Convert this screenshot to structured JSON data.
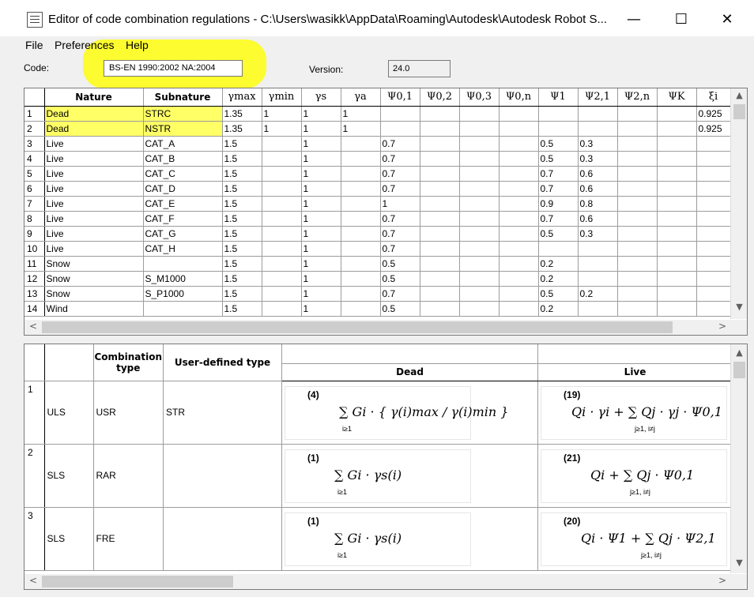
{
  "window": {
    "title": "Editor of code combination regulations - C:\\Users\\wasikk\\AppData\\Roaming\\Autodesk\\Autodesk Robot S...",
    "minimize": "—",
    "maximize": "☐",
    "close": "✕"
  },
  "menu": [
    "File",
    "Preferences",
    "Help"
  ],
  "code": {
    "label": "Code:",
    "value": "BS-EN 1990:2002 NA:2004"
  },
  "version": {
    "label": "Version:",
    "value": "24.0"
  },
  "table1": {
    "headers": [
      "Nature",
      "Subnature",
      "γmax",
      "γmin",
      "γs",
      "γa",
      "Ψ0,1",
      "Ψ0,2",
      "Ψ0,3",
      "Ψ0,n",
      "Ψ1",
      "Ψ2,1",
      "Ψ2,n",
      "ΨK",
      "ξi"
    ],
    "rows": [
      [
        "1",
        "Dead",
        "STRC",
        "1.35",
        "1",
        "1",
        "1",
        "",
        "",
        "",
        "",
        "",
        "",
        "",
        "",
        "0.925"
      ],
      [
        "2",
        "Dead",
        "NSTR",
        "1.35",
        "1",
        "1",
        "1",
        "",
        "",
        "",
        "",
        "",
        "",
        "",
        "",
        "0.925"
      ],
      [
        "3",
        "Live",
        "CAT_A",
        "1.5",
        "",
        "1",
        "",
        "0.7",
        "",
        "",
        "",
        "0.5",
        "0.3",
        "",
        "",
        ""
      ],
      [
        "4",
        "Live",
        "CAT_B",
        "1.5",
        "",
        "1",
        "",
        "0.7",
        "",
        "",
        "",
        "0.5",
        "0.3",
        "",
        "",
        ""
      ],
      [
        "5",
        "Live",
        "CAT_C",
        "1.5",
        "",
        "1",
        "",
        "0.7",
        "",
        "",
        "",
        "0.7",
        "0.6",
        "",
        "",
        ""
      ],
      [
        "6",
        "Live",
        "CAT_D",
        "1.5",
        "",
        "1",
        "",
        "0.7",
        "",
        "",
        "",
        "0.7",
        "0.6",
        "",
        "",
        ""
      ],
      [
        "7",
        "Live",
        "CAT_E",
        "1.5",
        "",
        "1",
        "",
        "1",
        "",
        "",
        "",
        "0.9",
        "0.8",
        "",
        "",
        ""
      ],
      [
        "8",
        "Live",
        "CAT_F",
        "1.5",
        "",
        "1",
        "",
        "0.7",
        "",
        "",
        "",
        "0.7",
        "0.6",
        "",
        "",
        ""
      ],
      [
        "9",
        "Live",
        "CAT_G",
        "1.5",
        "",
        "1",
        "",
        "0.7",
        "",
        "",
        "",
        "0.5",
        "0.3",
        "",
        "",
        ""
      ],
      [
        "10",
        "Live",
        "CAT_H",
        "1.5",
        "",
        "1",
        "",
        "0.7",
        "",
        "",
        "",
        "",
        "",
        "",
        "",
        ""
      ],
      [
        "11",
        "Snow",
        "",
        "1.5",
        "",
        "1",
        "",
        "0.5",
        "",
        "",
        "",
        "0.2",
        "",
        "",
        "",
        ""
      ],
      [
        "12",
        "Snow",
        "S_M1000",
        "1.5",
        "",
        "1",
        "",
        "0.5",
        "",
        "",
        "",
        "0.2",
        "",
        "",
        "",
        ""
      ],
      [
        "13",
        "Snow",
        "S_P1000",
        "1.5",
        "",
        "1",
        "",
        "0.7",
        "",
        "",
        "",
        "0.5",
        "0.2",
        "",
        "",
        ""
      ],
      [
        "14",
        "Wind",
        "",
        "1.5",
        "",
        "1",
        "",
        "0.5",
        "",
        "",
        "",
        "0.2",
        "",
        "",
        "",
        ""
      ]
    ]
  },
  "table2": {
    "headers": {
      "combination_type": "Combination type",
      "user_defined_type": "User-defined type",
      "dead": "Dead",
      "live": "Live"
    },
    "rows": [
      {
        "num": "1",
        "state": "ULS",
        "type": "USR",
        "user": "STR",
        "dead": {
          "id": "(4)",
          "expr": "∑ Gi · { γ(i)max / γ(i)min }",
          "sub": "i≥1"
        },
        "live": {
          "id": "(19)",
          "expr": "Qi · γi  +  ∑ Qj · γj · Ψ0,1",
          "sub": "j≥1, i≠j"
        }
      },
      {
        "num": "2",
        "state": "SLS",
        "type": "RAR",
        "user": "",
        "dead": {
          "id": "(1)",
          "expr": "∑ Gi · γs(i)",
          "sub": "i≥1"
        },
        "live": {
          "id": "(21)",
          "expr": "Qi  +  ∑ Qj · Ψ0,1",
          "sub": "j≥1, i≠j"
        }
      },
      {
        "num": "3",
        "state": "SLS",
        "type": "FRE",
        "user": "",
        "dead": {
          "id": "(1)",
          "expr": "∑ Gi · γs(i)",
          "sub": "i≥1"
        },
        "live": {
          "id": "(20)",
          "expr": "Qi · Ψ1  +  ∑ Qj · Ψ2,1",
          "sub": "j≥1, i≠j"
        }
      }
    ]
  },
  "scroll": {
    "up": "▲",
    "down": "▼",
    "left": "<",
    "right": ">"
  }
}
